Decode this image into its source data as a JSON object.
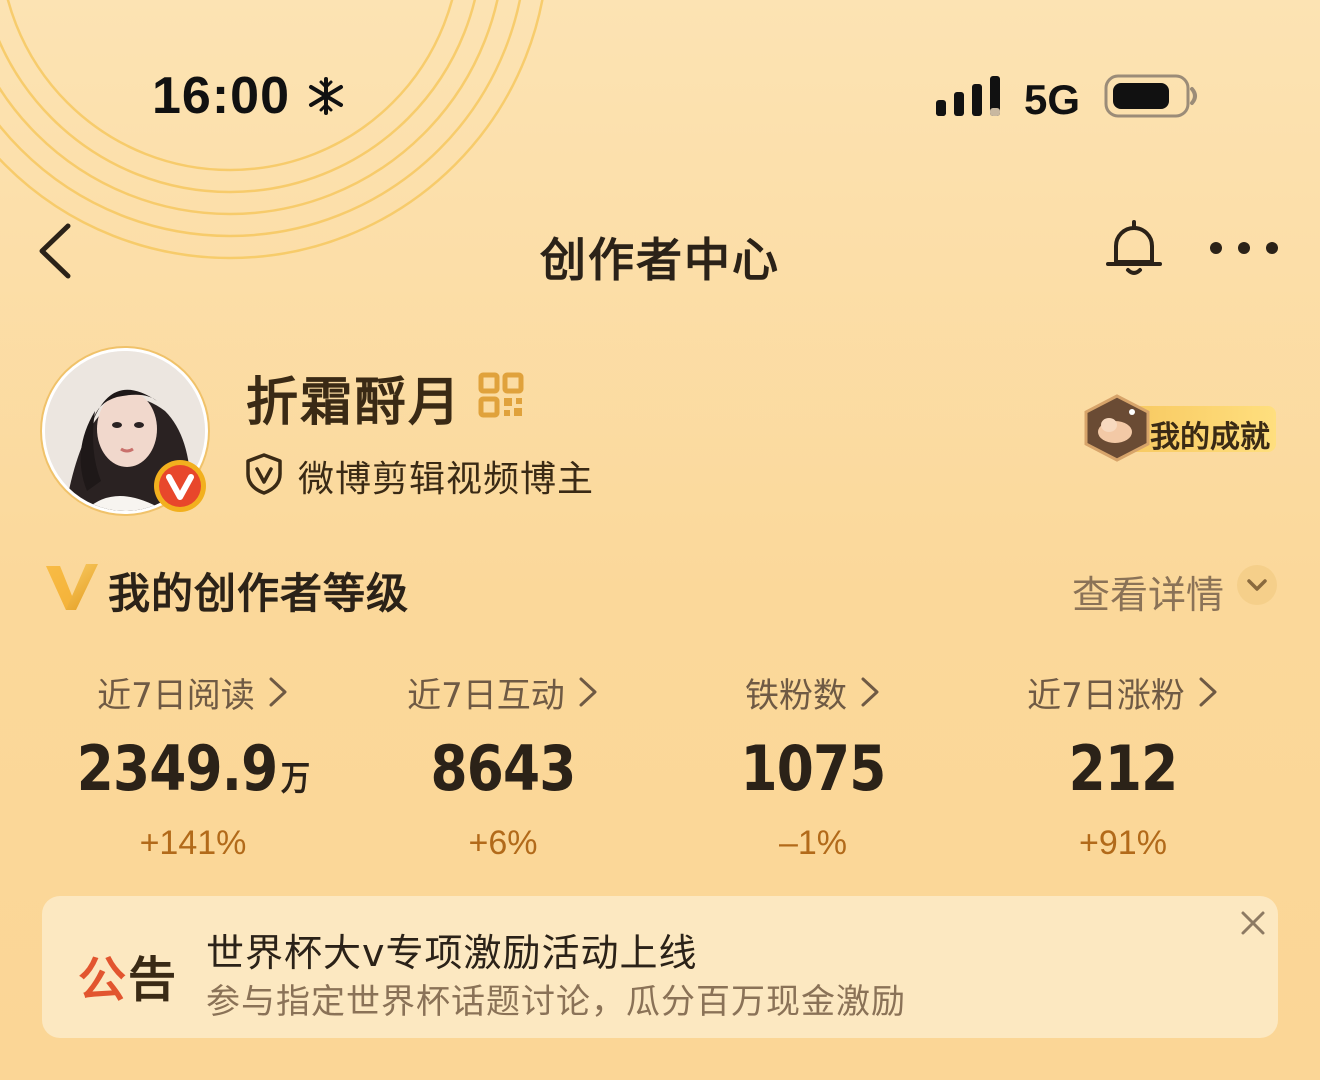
{
  "status_bar": {
    "time": "16:00",
    "network": "5G"
  },
  "nav": {
    "title": "创作者中心"
  },
  "profile": {
    "username": "折霜酹月",
    "certification": "微博剪辑视频博主",
    "achievement_label": "我的成就"
  },
  "level": {
    "title": "我的创作者等级",
    "details_label": "查看详情"
  },
  "stats": [
    {
      "label": "近7日阅读",
      "value": "2349.9",
      "unit": "万",
      "delta": "+141%"
    },
    {
      "label": "近7日互动",
      "value": "8643",
      "unit": "",
      "delta": "+6%"
    },
    {
      "label": "铁粉数",
      "value": "1075",
      "unit": "",
      "delta": "–1%"
    },
    {
      "label": "近7日涨粉",
      "value": "212",
      "unit": "",
      "delta": "+91%"
    }
  ],
  "notice": {
    "tag_part1": "公",
    "tag_part2": "告",
    "title": "世界杯大v专项激励活动上线",
    "subtitle": "参与指定世界杯话题讨论，瓜分百万现金激励"
  },
  "colors": {
    "accent_orange": "#e2552f",
    "delta_brown": "#b26a1a",
    "gold": "#f0b53c"
  }
}
